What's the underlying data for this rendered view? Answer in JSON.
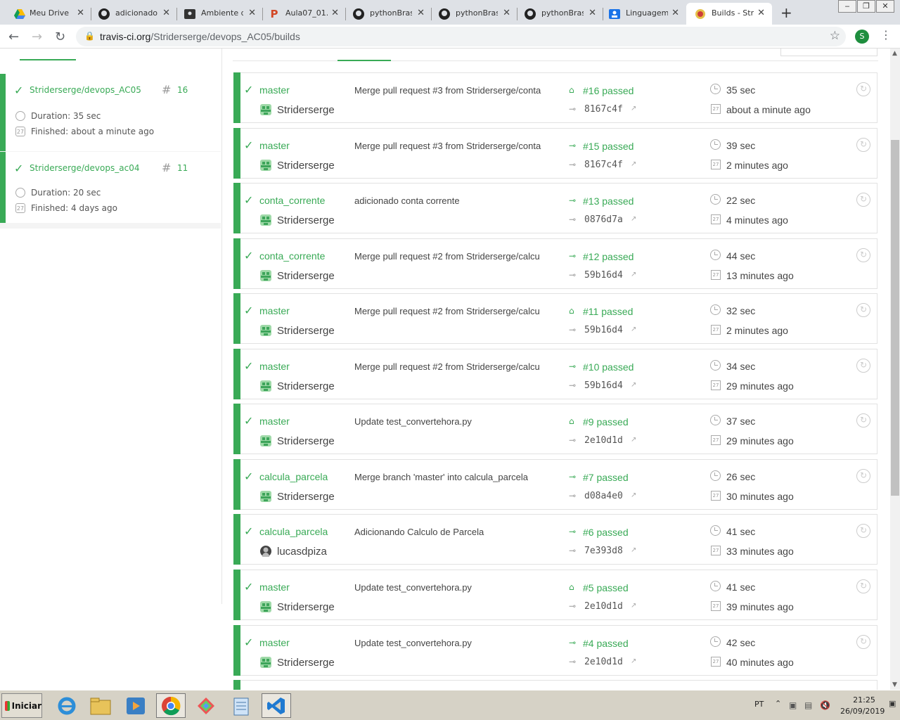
{
  "browser": {
    "tabs": [
      {
        "title": "Meu Drive -",
        "icon": "google-drive-icon"
      },
      {
        "title": "adicionado c",
        "icon": "github-icon"
      },
      {
        "title": "Ambiente de",
        "icon": "classroom-icon"
      },
      {
        "title": "Aula07_01.p",
        "icon": "powerpoint-icon"
      },
      {
        "title": "pythonBrasi",
        "icon": "github-icon"
      },
      {
        "title": "pythonBrasi",
        "icon": "github-icon"
      },
      {
        "title": "pythonBrasi",
        "icon": "github-icon"
      },
      {
        "title": "Linguagem c",
        "icon": "contacts-icon"
      },
      {
        "title": "Builds - Stric",
        "icon": "travis-icon"
      }
    ],
    "url_host": "travis-ci.org",
    "url_path": "/Striderserge/devops_AC05/builds",
    "profile_initial": "S"
  },
  "sidebar": {
    "repos": [
      {
        "name": "Striderserge/devops_AC05",
        "number": "16",
        "duration": "Duration: 35 sec",
        "finished": "Finished: about a minute ago"
      },
      {
        "name": "Striderserge/devops_ac04",
        "number": "11",
        "duration": "Duration: 20 sec",
        "finished": "Finished: 4 days ago"
      }
    ]
  },
  "builds": [
    {
      "branch": "master",
      "author": "Striderserge",
      "message": "Merge pull request #3 from Striderserge/conta",
      "status": "#16 passed",
      "sha": "8167c4f",
      "duration": "35 sec",
      "finished": "about a minute ago"
    },
    {
      "branch": "master",
      "author": "Striderserge",
      "message": "Merge pull request #3 from Striderserge/conta",
      "status": "#15 passed",
      "sha": "8167c4f",
      "duration": "39 sec",
      "finished": "2 minutes ago"
    },
    {
      "branch": "conta_corrente",
      "author": "Striderserge",
      "message": "adicionado conta corrente",
      "status": "#13 passed",
      "sha": "0876d7a",
      "duration": "22 sec",
      "finished": "4 minutes ago"
    },
    {
      "branch": "conta_corrente",
      "author": "Striderserge",
      "message": "Merge pull request #2 from Striderserge/calcu",
      "status": "#12 passed",
      "sha": "59b16d4",
      "duration": "44 sec",
      "finished": "13 minutes ago"
    },
    {
      "branch": "master",
      "author": "Striderserge",
      "message": "Merge pull request #2 from Striderserge/calcu",
      "status": "#11 passed",
      "sha": "59b16d4",
      "duration": "32 sec",
      "finished": "2 minutes ago"
    },
    {
      "branch": "master",
      "author": "Striderserge",
      "message": "Merge pull request #2 from Striderserge/calcu",
      "status": "#10 passed",
      "sha": "59b16d4",
      "duration": "34 sec",
      "finished": "29 minutes ago"
    },
    {
      "branch": "master",
      "author": "Striderserge",
      "message": "Update test_convertehora.py",
      "status": "#9 passed",
      "sha": "2e10d1d",
      "duration": "37 sec",
      "finished": "29 minutes ago"
    },
    {
      "branch": "calcula_parcela",
      "author": "Striderserge",
      "message": "Merge branch 'master' into calcula_parcela",
      "status": "#7 passed",
      "sha": "d08a4e0",
      "duration": "26 sec",
      "finished": "30 minutes ago"
    },
    {
      "branch": "calcula_parcela",
      "author": "lucasdpiza",
      "message": "Adicionando Calculo de Parcela",
      "status": "#6 passed",
      "sha": "7e393d8",
      "duration": "41 sec",
      "finished": "33 minutes ago"
    },
    {
      "branch": "master",
      "author": "Striderserge",
      "message": "Update test_convertehora.py",
      "status": "#5 passed",
      "sha": "2e10d1d",
      "duration": "41 sec",
      "finished": "39 minutes ago"
    },
    {
      "branch": "master",
      "author": "Striderserge",
      "message": "Update test_convertehora.py",
      "status": "#4 passed",
      "sha": "2e10d1d",
      "duration": "42 sec",
      "finished": "40 minutes ago"
    }
  ],
  "taskbar": {
    "start_label": "Iniciar",
    "lang": "PT",
    "time": "21:25",
    "date": "26/09/2019"
  },
  "colors": {
    "accent": "#39aa56"
  }
}
